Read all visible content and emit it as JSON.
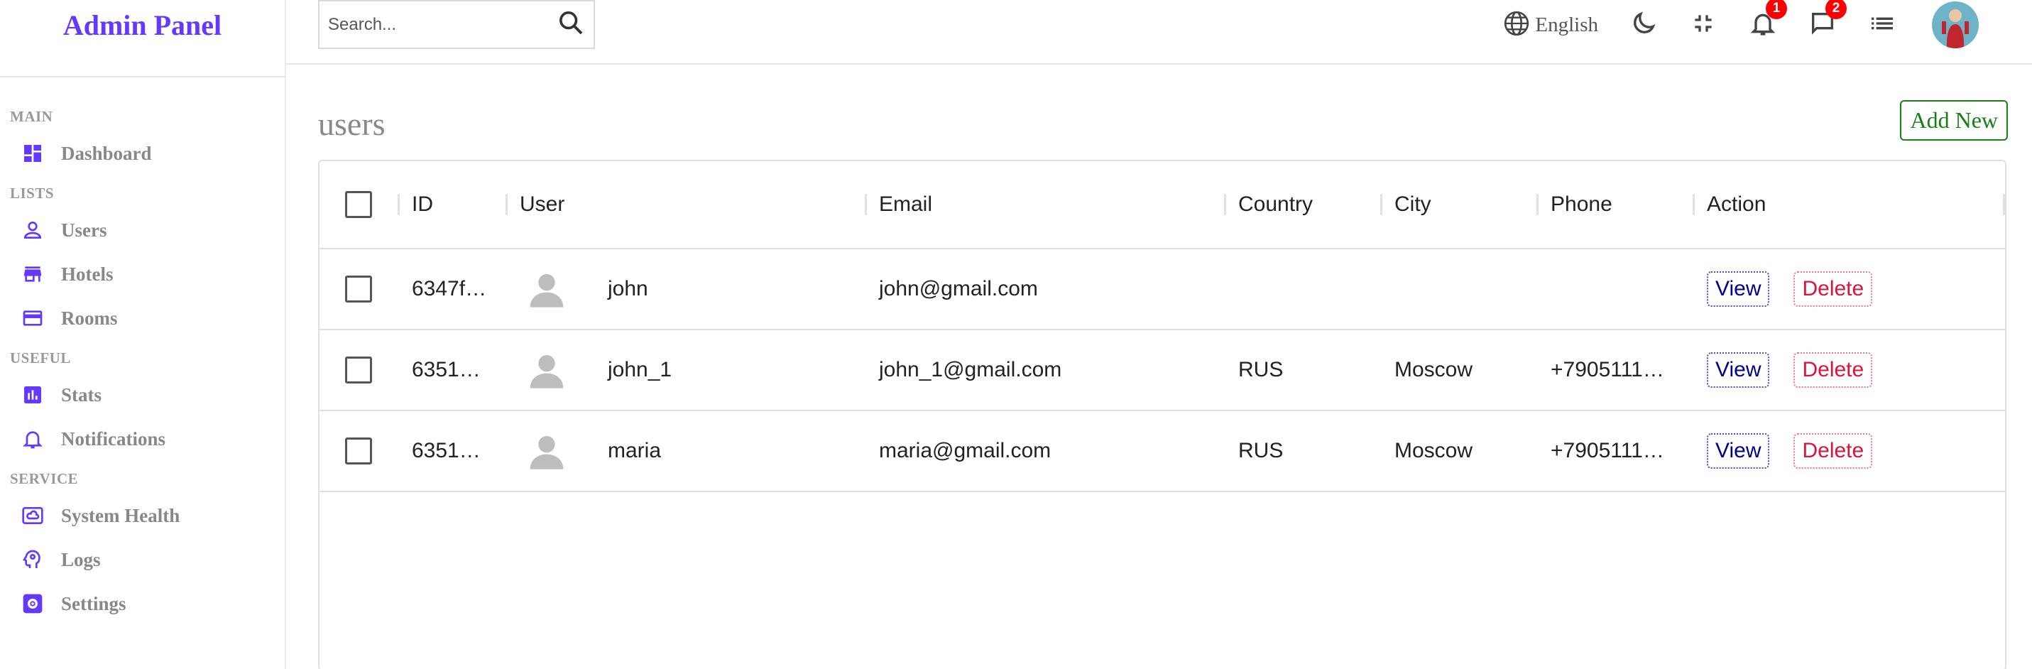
{
  "app": {
    "title": "Admin Panel",
    "brand_color": "#6439ff"
  },
  "sidebar": {
    "sections": [
      {
        "title": "MAIN",
        "items": [
          {
            "label": "Dashboard",
            "icon": "dashboard-icon"
          }
        ]
      },
      {
        "title": "LISTS",
        "items": [
          {
            "label": "Users",
            "icon": "person-icon"
          },
          {
            "label": "Hotels",
            "icon": "store-icon"
          },
          {
            "label": "Rooms",
            "icon": "credit-card-icon"
          }
        ]
      },
      {
        "title": "USEFUL",
        "items": [
          {
            "label": "Stats",
            "icon": "insert-chart-icon"
          },
          {
            "label": "Notifications",
            "icon": "bell-icon"
          }
        ]
      },
      {
        "title": "SERVICE",
        "items": [
          {
            "label": "System Health",
            "icon": "cloud-icon"
          },
          {
            "label": "Logs",
            "icon": "psychology-icon"
          },
          {
            "label": "Settings",
            "icon": "settings-icon"
          }
        ]
      }
    ]
  },
  "topbar": {
    "search_placeholder": "Search...",
    "language": "English",
    "notifications_count": "1",
    "messages_count": "2"
  },
  "page": {
    "title": "users",
    "add_new_label": "Add New"
  },
  "table": {
    "columns": [
      "ID",
      "User",
      "Email",
      "Country",
      "City",
      "Phone",
      "Action"
    ],
    "rows": [
      {
        "id": "6347f…",
        "user": "john",
        "email": "john@gmail.com",
        "country": "",
        "city": "",
        "phone": ""
      },
      {
        "id": "6351…",
        "user": "john_1",
        "email": "john_1@gmail.com",
        "country": "RUS",
        "city": "Moscow",
        "phone": "+7905111…"
      },
      {
        "id": "6351…",
        "user": "maria",
        "email": "maria@gmail.com",
        "country": "RUS",
        "city": "Moscow",
        "phone": "+7905111…"
      }
    ],
    "view_label": "View",
    "delete_label": "Delete"
  },
  "colors": {
    "accent": "#6439ff",
    "add_new": "#178017",
    "view": "#00008b",
    "delete": "#dc143c",
    "badge": "#ff0000"
  }
}
